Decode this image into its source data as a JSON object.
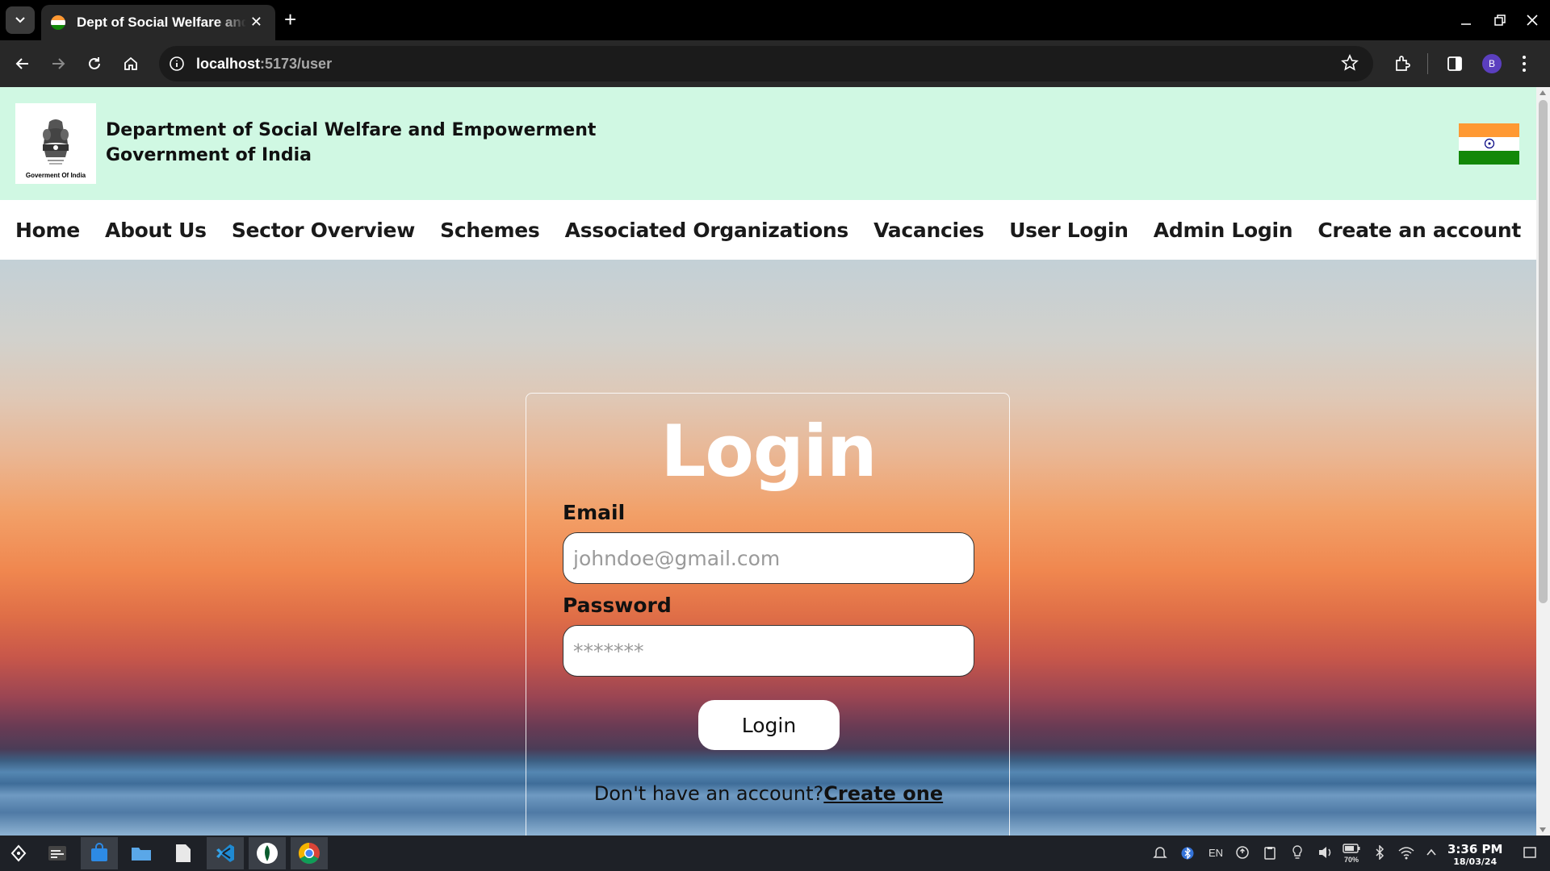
{
  "browser": {
    "tab_title": "Dept of Social Welfare and Empowerment",
    "tab_close": "✕",
    "new_tab": "+",
    "url_host": "localhost",
    "url_rest": ":5173/user",
    "profile_initial": "B"
  },
  "header": {
    "emblem_caption": "Goverment Of India",
    "dept_line1": "Department of Social Welfare and Empowerment",
    "dept_line2": "Government of India"
  },
  "nav": {
    "items": [
      "Home",
      "About Us",
      "Sector Overview",
      "Schemes",
      "Associated Organizations",
      "Vacancies",
      "User Login",
      "Admin Login",
      "Create an account"
    ]
  },
  "login": {
    "title": "Login",
    "email_label": "Email",
    "email_placeholder": "johndoe@gmail.com",
    "password_label": "Password",
    "password_placeholder": "*******",
    "button": "Login",
    "signup_prompt": "Don't have an account?",
    "signup_link": "Create one"
  },
  "taskbar": {
    "lang": "EN",
    "battery": "70%",
    "time": "3:36 PM",
    "date": "18/03/24"
  },
  "colors": {
    "header_bg": "#d0f8e3",
    "flag_saffron": "#ff9933",
    "flag_green": "#138808",
    "chakra": "#000080"
  }
}
